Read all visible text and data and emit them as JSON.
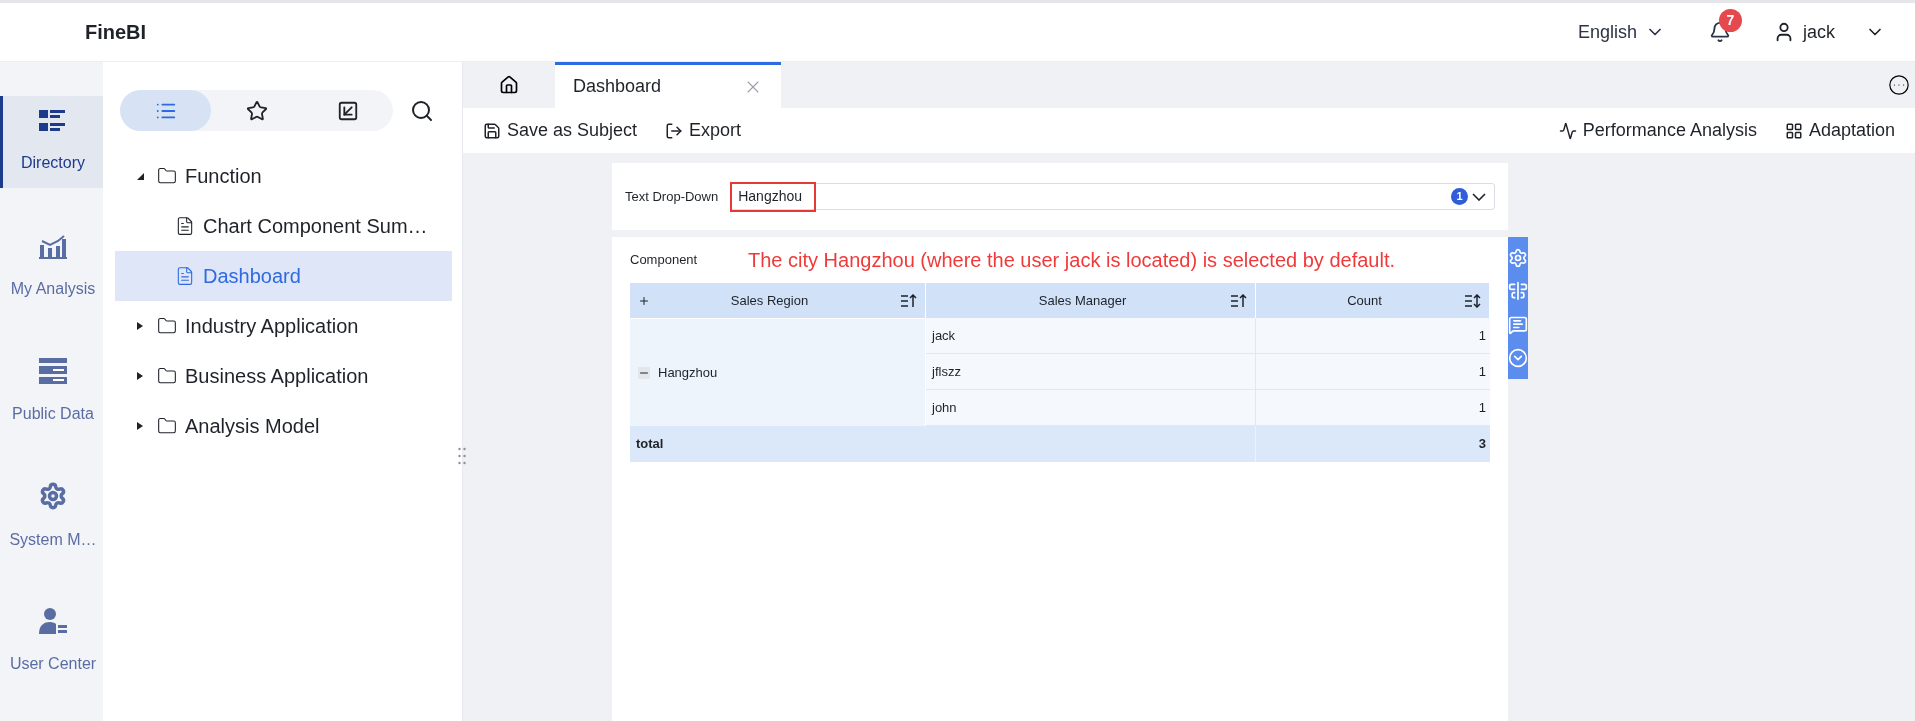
{
  "header": {
    "logo": "FineBI",
    "language": "English",
    "notifications": "7",
    "user": "jack"
  },
  "nav": [
    {
      "kind": "directory",
      "label": "Directory",
      "selected": true
    },
    {
      "kind": "analysis",
      "label": "My Analysis",
      "selected": false
    },
    {
      "kind": "data",
      "label": "Public Data",
      "selected": false
    },
    {
      "kind": "system",
      "label": "System M…",
      "selected": false
    },
    {
      "kind": "user",
      "label": "User Center",
      "selected": false
    }
  ],
  "tree_toolbar": [
    {
      "kind": "list",
      "selected": true
    },
    {
      "kind": "star",
      "selected": false
    },
    {
      "kind": "import",
      "selected": false
    }
  ],
  "tree": [
    {
      "kind": "folder",
      "label": "Function",
      "expanded": true,
      "children": [
        {
          "kind": "file",
          "label": "Chart Component Sum…",
          "selected": false
        },
        {
          "kind": "file",
          "label": "Dashboard",
          "selected": true
        }
      ]
    },
    {
      "kind": "folder",
      "label": "Industry Application",
      "expanded": false
    },
    {
      "kind": "folder",
      "label": "Business Application",
      "expanded": false
    },
    {
      "kind": "folder",
      "label": "Analysis Model",
      "expanded": false
    }
  ],
  "tabs": [
    {
      "label": "Dashboard",
      "selected": true
    }
  ],
  "toolbar_left": [
    {
      "kind": "save",
      "label": "Save as Subject"
    },
    {
      "kind": "export",
      "label": "Export"
    }
  ],
  "toolbar_right": [
    {
      "kind": "performance",
      "label": "Performance Analysis"
    },
    {
      "kind": "adaptation",
      "label": "Adaptation"
    }
  ],
  "filter": {
    "label": "Text Drop-Down",
    "value": "Hangzhou",
    "count": "1"
  },
  "annotation": "The city Hangzhou (where the user jack is located) is selected by default.",
  "component": {
    "title": "Component",
    "table": {
      "columns": [
        "Sales Region",
        "Sales Manager",
        "Count"
      ],
      "region": "Hangzhou",
      "rows": [
        {
          "manager": "jack",
          "count": "1"
        },
        {
          "manager": "jflszz",
          "count": "1"
        },
        {
          "manager": "john",
          "count": "1"
        }
      ],
      "total": {
        "label": "total",
        "count": "3"
      }
    }
  }
}
